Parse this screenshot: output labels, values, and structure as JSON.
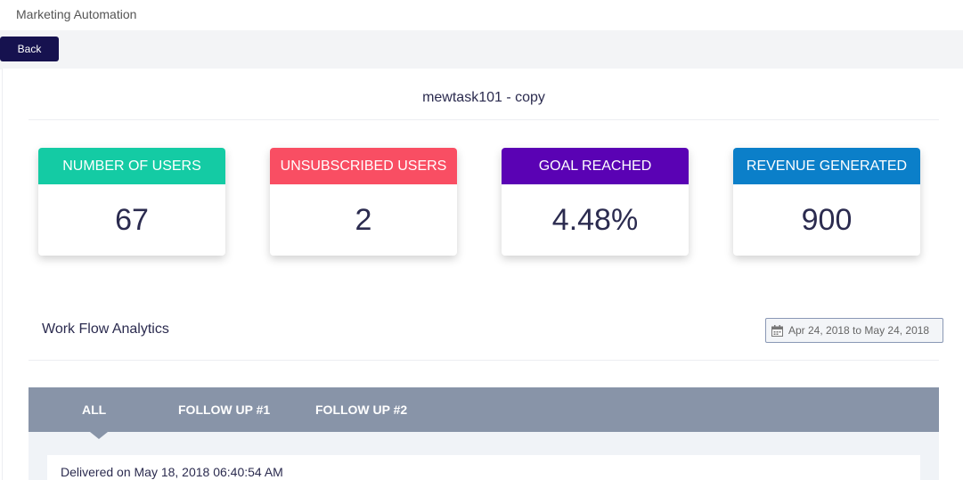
{
  "app": {
    "title": "Marketing Automation"
  },
  "toolbar": {
    "back_label": "Back"
  },
  "page": {
    "title": "mewtask101 - copy"
  },
  "stats": [
    {
      "label": "NUMBER OF USERS",
      "value": "67",
      "color": "#14cba4"
    },
    {
      "label": "UNSUBSCRIBED USERS",
      "value": "2",
      "color": "#f94e63"
    },
    {
      "label": "GOAL REACHED",
      "value": "4.48%",
      "color": "#5a02b4"
    },
    {
      "label": "REVENUE GENERATED",
      "value": "900",
      "color": "#0b7fc9"
    }
  ],
  "analytics": {
    "title": "Work Flow Analytics",
    "date_range": "Apr 24, 2018 to May 24, 2018",
    "tabs": [
      {
        "label": "ALL",
        "active": true
      },
      {
        "label": "FOLLOW UP #1",
        "active": false
      },
      {
        "label": "FOLLOW UP #2",
        "active": false
      }
    ],
    "delivered": "Delivered on May 18, 2018 06:40:54 AM"
  },
  "colors": {
    "back_button": "#16124f",
    "tab_bar": "#8894a8"
  },
  "icons": {
    "date_range": "calendar-icon"
  }
}
